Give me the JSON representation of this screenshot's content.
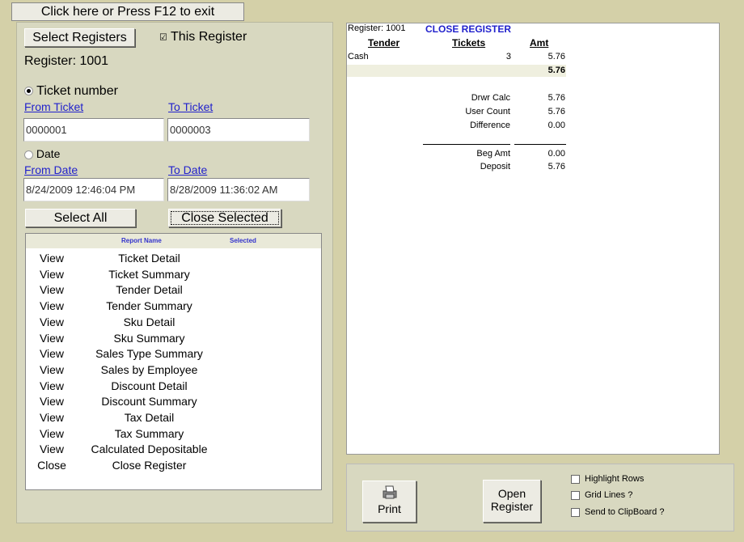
{
  "top_button": "Click here or Press F12 to exit",
  "left": {
    "select_registers": "Select Registers",
    "this_register": "This Register",
    "register_label": "Register: 1001",
    "ticket_number": "Ticket number",
    "from_ticket": "From Ticket",
    "to_ticket": "To Ticket",
    "from_ticket_value": "0000001",
    "to_ticket_value": "0000003",
    "date_label": "Date",
    "from_date": "From Date",
    "to_date": "To Date",
    "from_date_value": "8/24/2009 12:46:04 PM",
    "to_date_value": "8/28/2009 11:36:02 AM",
    "select_all": "Select All",
    "close_selected": "Close Selected"
  },
  "report_list": {
    "headers": {
      "name": "Report Name",
      "selected": "Selected"
    },
    "rows": [
      {
        "action": "View",
        "name": "Ticket Detail"
      },
      {
        "action": "View",
        "name": "Ticket Summary"
      },
      {
        "action": "View",
        "name": "Tender Detail"
      },
      {
        "action": "View",
        "name": "Tender Summary"
      },
      {
        "action": "View",
        "name": "Sku Detail"
      },
      {
        "action": "View",
        "name": "Sku Summary"
      },
      {
        "action": "View",
        "name": "Sales Type Summary"
      },
      {
        "action": "View",
        "name": "Sales by Employee"
      },
      {
        "action": "View",
        "name": "Discount Detail"
      },
      {
        "action": "View",
        "name": "Discount Summary"
      },
      {
        "action": "View",
        "name": "Tax Detail"
      },
      {
        "action": "View",
        "name": "Tax Summary"
      },
      {
        "action": "View",
        "name": "Calculated Depositable"
      },
      {
        "action": "Close",
        "name": "Close Register"
      }
    ]
  },
  "report": {
    "register": "Register: 1001",
    "title": "CLOSE REGISTER",
    "col_tender": "Tender",
    "col_tickets": "Tickets",
    "col_amt": "Amt",
    "row_tender": "Cash",
    "row_tickets": "3",
    "row_amt": "5.76",
    "total_amt": "5.76",
    "drwr_calc_label": "Drwr Calc",
    "drwr_calc": "5.76",
    "user_count_label": "User Count",
    "user_count": "5.76",
    "difference_label": "Difference",
    "difference": "0.00",
    "beg_amt_label": "Beg Amt",
    "beg_amt": "0.00",
    "deposit_label": "Deposit",
    "deposit": "5.76"
  },
  "bottom": {
    "print": "Print",
    "open_register_1": "Open",
    "open_register_2": "Register",
    "highlight_rows": "Highlight Rows",
    "grid_lines": "Grid Lines ?",
    "send_clipboard": "Send to ClipBoard ?"
  },
  "colors": {
    "link": "#2222cc",
    "report_title": "#2222cc",
    "background": "#d4d0a8"
  }
}
